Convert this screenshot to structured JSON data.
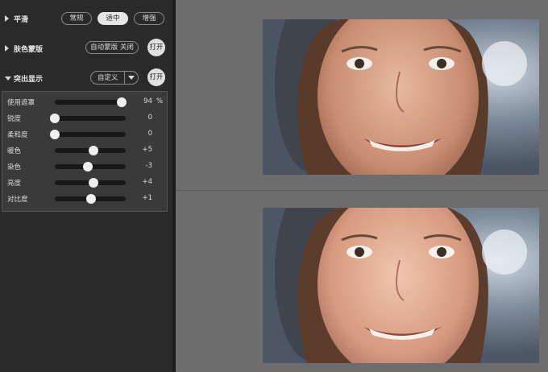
{
  "smoothing": {
    "title": "平滑",
    "options": [
      "常规",
      "适中",
      "增强"
    ],
    "selected": "适中"
  },
  "skin_mask": {
    "title": "肤色蒙版",
    "auto_mask_label": "自动蒙版 关闭",
    "toggle_label": "打开"
  },
  "highlight": {
    "title": "突出显示",
    "preset_value": "自定义",
    "toggle_label": "打开",
    "sliders": [
      {
        "label": "使用遮罩",
        "value": 94,
        "display": "94",
        "unit": "%",
        "min": 0,
        "max": 100
      },
      {
        "label": "锐度",
        "value": 0,
        "display": "0",
        "unit": "",
        "min": 0,
        "max": 100
      },
      {
        "label": "柔和度",
        "value": 0,
        "display": "0",
        "unit": "",
        "min": 0,
        "max": 100
      },
      {
        "label": "暖色",
        "value": 5,
        "display": "+5",
        "unit": "",
        "min": -50,
        "max": 50
      },
      {
        "label": "染色",
        "value": -3,
        "display": "-3",
        "unit": "",
        "min": -50,
        "max": 50
      },
      {
        "label": "亮度",
        "value": 4,
        "display": "+4",
        "unit": "",
        "min": -50,
        "max": 50
      },
      {
        "label": "对比度",
        "value": 1,
        "display": "+1",
        "unit": "",
        "min": -50,
        "max": 50
      }
    ]
  },
  "colors": {
    "panel_bg": "#2a2a2a",
    "preview_bg": "#6d6d6d",
    "active_button": "#e6e6e6"
  }
}
